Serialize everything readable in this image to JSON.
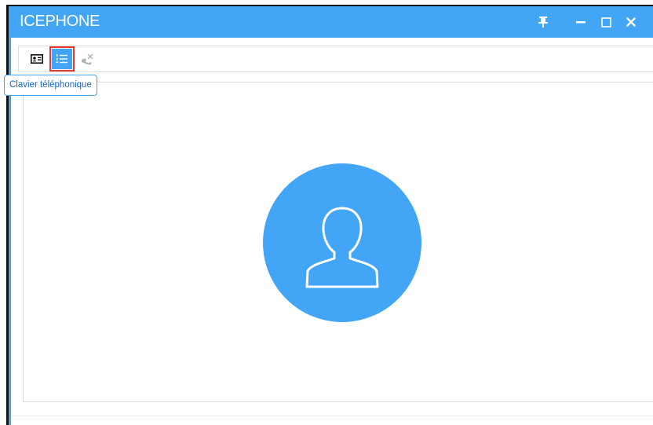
{
  "window": {
    "title": "ICEPHONE",
    "controls": {
      "pin": "pin-icon",
      "minimize": "minimize-icon",
      "maximize": "maximize-icon",
      "close": "close-icon"
    }
  },
  "toolbar": {
    "items": [
      {
        "icon": "contact-card-icon",
        "selected": false
      },
      {
        "icon": "keypad-list-icon",
        "selected": true
      },
      {
        "icon": "hangup-phone-icon",
        "selected": false,
        "disabled": true
      }
    ]
  },
  "tooltip": {
    "text": "Clavier téléphonique"
  },
  "main": {
    "avatar": "user-avatar-icon"
  },
  "colors": {
    "accent": "#42a5f5",
    "highlight": "#e53935"
  }
}
